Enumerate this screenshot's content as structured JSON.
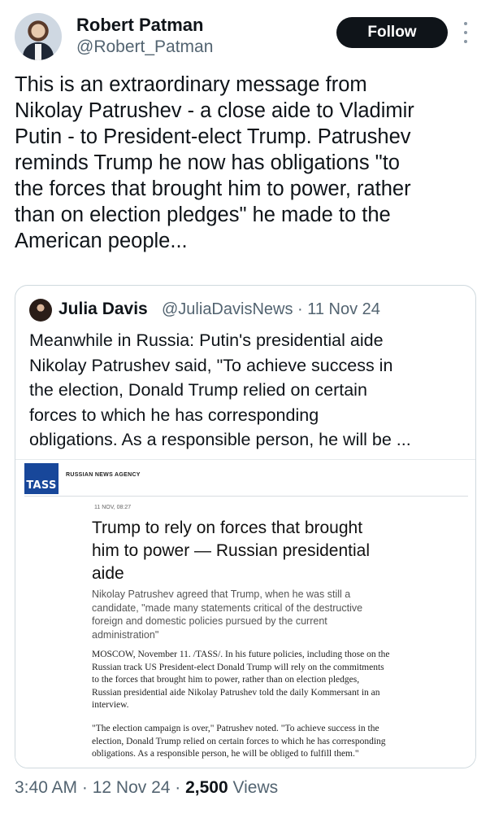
{
  "author": {
    "display_name": "Robert Patman",
    "handle": "@Robert_Patman",
    "follow_label": "Follow"
  },
  "tweet": {
    "text": "This is an extraordinary message from\nNikolay Patrushev - a close aide to Vladimir\nPutin - to President-elect Trump. Patrushev\nreminds Trump he now has obligations \"to\nthe forces that brought him to power, rather\nthan on election pledges\" he made to the\nAmerican people..."
  },
  "quote": {
    "display_name": "Julia Davis",
    "handle_date": "@JuliaDavisNews · 11 Nov 24",
    "text": "Meanwhile in Russia: Putin's presidential aide\nNikolay Patrushev said, \"To achieve success in\nthe election, Donald Trump relied on certain\nforces to which he has corresponding\nobligations. As a responsible person, he will be ...",
    "article": {
      "logo_text": "TASS",
      "agency": "RUSSIAN NEWS AGENCY",
      "date": "11 NOV, 08:27",
      "headline": "Trump to rely on forces that brought\nhim to power — Russian presidential\naide",
      "lead": "Nikolay Patrushev agreed that Trump, when he was still a\ncandidate, \"made many statements critical of the destructive\nforeign and domestic policies pursued by the current\nadministration\"",
      "body_1": "MOSCOW, November 11. /TASS/. In his future policies, including those on the\nRussian track US President-elect Donald Trump will rely on the commitments\nto the forces that brought him to power, rather than on election pledges,\nRussian presidential aide Nikolay Patrushev told the daily Kommersant in an\ninterview.",
      "body_2": "\"The election campaign is over,\" Patrushev noted. \"To achieve success in the\nelection, Donald Trump relied on certain forces to which he has corresponding\nobligations. As a responsible person, he will be obliged to fulfill them.\""
    }
  },
  "meta": {
    "time_date": "3:40 AM · 12 Nov 24 · ",
    "views_count": "2,500",
    "views_label": " Views"
  }
}
